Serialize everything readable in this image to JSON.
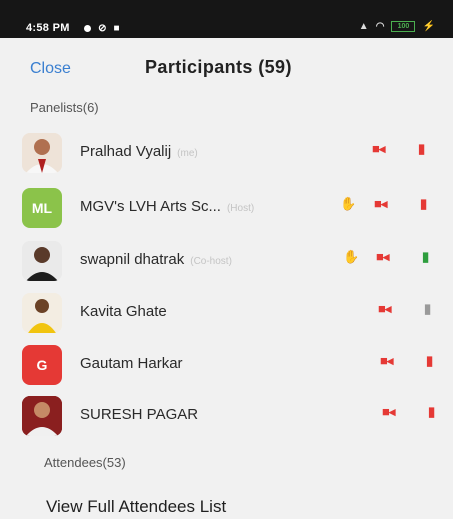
{
  "status_bar": {
    "time": "4:58 PM",
    "battery": "100"
  },
  "header": {
    "close_label": "Close",
    "title": "Participants (59)"
  },
  "panelists_label": "Panelists(6)",
  "panelists": [
    {
      "name": "Pralhad Vyalij",
      "tag": "(me)",
      "avatar": "photo",
      "raised_hand": false,
      "video_off": true,
      "mic": "muted"
    },
    {
      "name": "MGV's LVH Arts Sc...",
      "tag": "(Host)",
      "avatar": "ML",
      "avatar_color": "#8bc34a",
      "raised_hand": true,
      "video_off": true,
      "mic": "muted"
    },
    {
      "name": "swapnil dhatrak",
      "tag": "(Co-host)",
      "avatar": "photo",
      "raised_hand": true,
      "video_off": true,
      "mic": "unmuted"
    },
    {
      "name": "Kavita Ghate",
      "tag": "",
      "avatar": "photo",
      "raised_hand": false,
      "video_off": true,
      "mic": "off"
    },
    {
      "name": "Gautam Harkar",
      "tag": "",
      "avatar": "G",
      "avatar_color": "#e53935",
      "raised_hand": false,
      "video_off": true,
      "mic": "muted"
    },
    {
      "name": "SURESH PAGAR",
      "tag": "",
      "avatar": "photo",
      "raised_hand": false,
      "video_off": true,
      "mic": "muted"
    }
  ],
  "attendees_label": "Attendees(53)",
  "view_full_label": "View Full Attendees List",
  "icons": {
    "video_off": "video-off-icon",
    "mic_muted": "mic-muted-icon",
    "mic_on": "mic-icon",
    "raised_hand": "raised-hand-icon"
  },
  "colors": {
    "accent": "#3a7fd0",
    "muted": "#e53935",
    "mic_on": "#2e9e3e",
    "status_bar": "#161616"
  }
}
